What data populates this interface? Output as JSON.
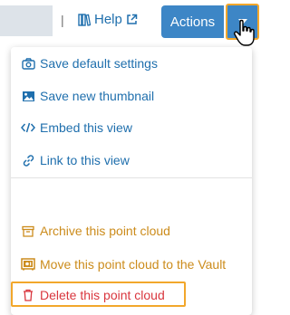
{
  "header": {
    "separator": "|",
    "help_label": "Help",
    "actions_label": "Actions"
  },
  "menu": {
    "items": [
      {
        "label": "Save default settings",
        "icon": "camera-icon",
        "color": "#1f6fad"
      },
      {
        "label": "Save new thumbnail",
        "icon": "image-icon",
        "color": "#1f6fad"
      },
      {
        "label": "Embed this view",
        "icon": "code-icon",
        "color": "#1f6fad"
      },
      {
        "label": "Link to this view",
        "icon": "link-icon",
        "color": "#1f6fad"
      },
      {
        "label": "Archive this point cloud",
        "icon": "archive-icon",
        "color": "#cc8c1c"
      },
      {
        "label": "Move this point cloud to the Vault",
        "icon": "vault-icon",
        "color": "#cc8c1c"
      },
      {
        "label": "Delete this point cloud",
        "icon": "trash-icon",
        "color": "#d9363e"
      }
    ]
  },
  "colors": {
    "accent": "#3d86c6",
    "highlight": "#f2a72b",
    "link": "#1f6fad",
    "warning": "#cc8c1c",
    "danger": "#d9363e"
  }
}
